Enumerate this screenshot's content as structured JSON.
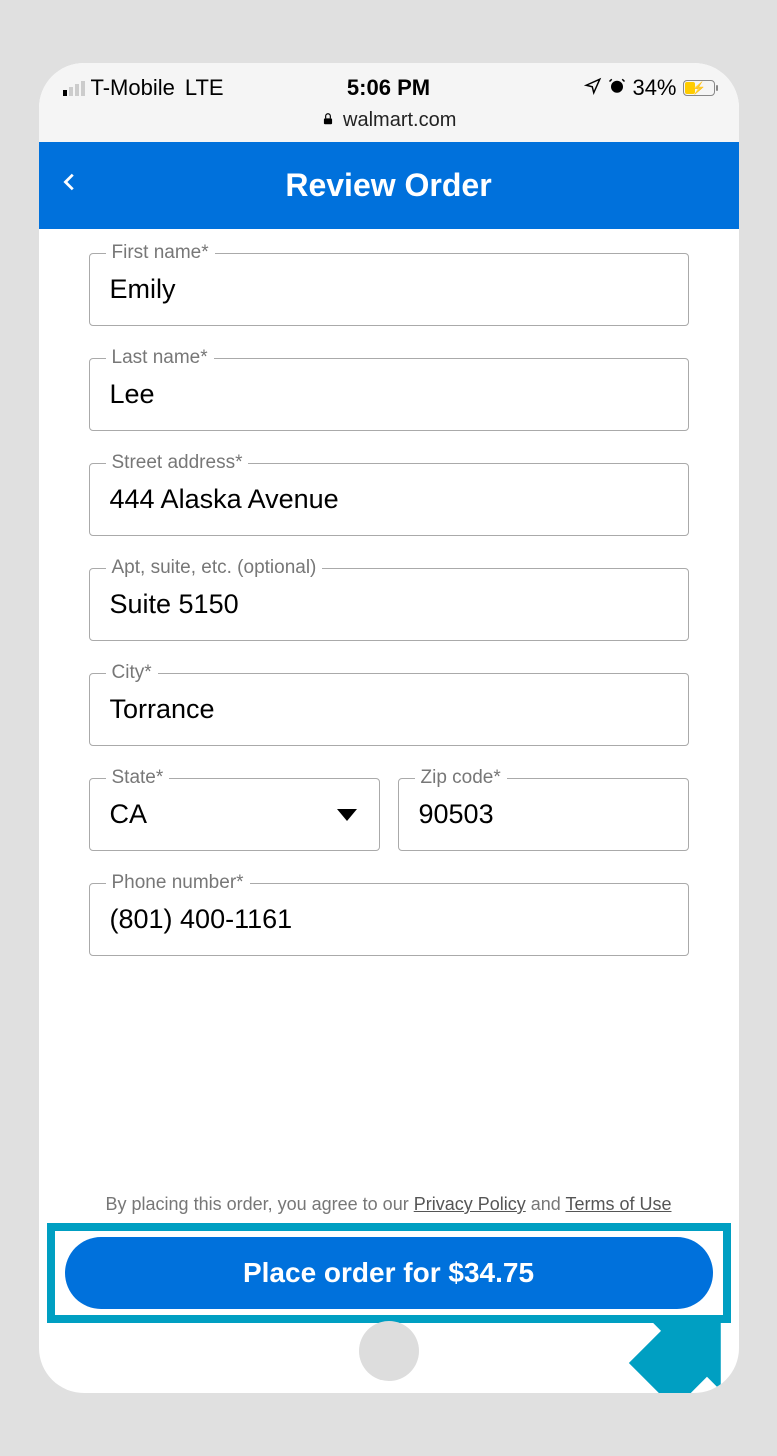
{
  "status": {
    "carrier": "T-Mobile",
    "network": "LTE",
    "time": "5:06 PM",
    "battery_pct": "34%"
  },
  "url_bar": {
    "domain": "walmart.com"
  },
  "header": {
    "title": "Review Order"
  },
  "form": {
    "first_name_label": "First name*",
    "first_name": "Emily",
    "last_name_label": "Last name*",
    "last_name": "Lee",
    "street_label": "Street address*",
    "street": "444 Alaska Avenue",
    "apt_label": "Apt, suite, etc. (optional)",
    "apt": "Suite 5150",
    "city_label": "City*",
    "city": "Torrance",
    "state_label": "State*",
    "state": "CA",
    "zip_label": "Zip code*",
    "zip": "90503",
    "phone_label": "Phone number*",
    "phone": "(801) 400-1161"
  },
  "footer": {
    "agree_prefix": "By placing this order, you agree to our ",
    "privacy": "Privacy Policy",
    "and": " and ",
    "terms": "Terms of Use",
    "button": "Place order for $34.75"
  }
}
